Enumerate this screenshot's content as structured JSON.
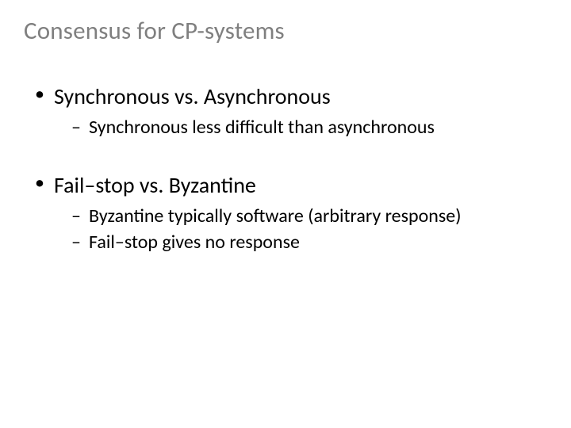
{
  "title": "Consensus for CP-systems",
  "bullets": [
    {
      "text": "Synchronous vs. Asynchronous",
      "sub": [
        "Synchronous less difficult than asynchronous"
      ]
    },
    {
      "text": "Fail–stop vs. Byzantine",
      "sub": [
        "Byzantine typically software (arbitrary response)",
        "Fail–stop gives no response"
      ]
    }
  ]
}
